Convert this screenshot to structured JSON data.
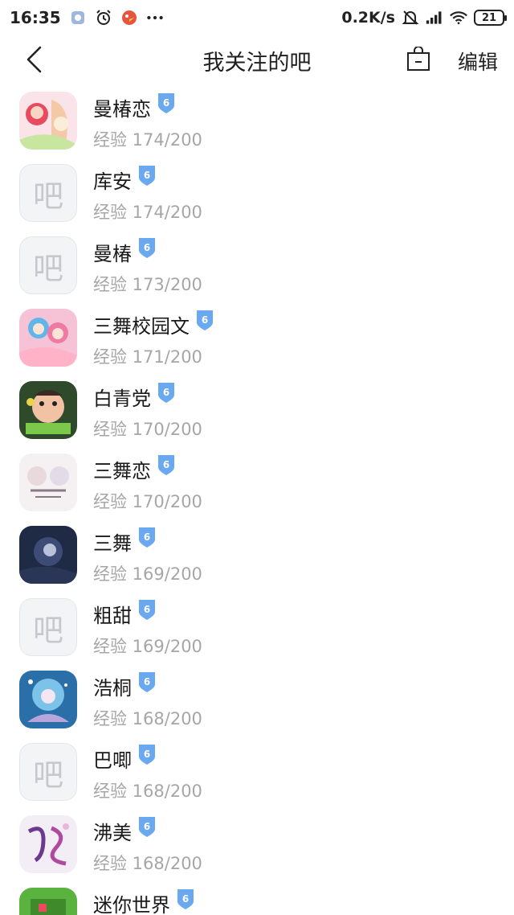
{
  "status_bar": {
    "time": "16:35",
    "net_speed": "0.2K/s",
    "battery": "21"
  },
  "nav": {
    "title": "我关注的吧",
    "edit_label": "编辑"
  },
  "placeholder_glyph": "吧",
  "badge_color": "#6aa8f0",
  "forums": [
    {
      "name": "曼椿恋",
      "level": "6",
      "exp": "经验 174/200",
      "avatar": "art-pink"
    },
    {
      "name": "库安",
      "level": "6",
      "exp": "经验 174/200",
      "avatar": "placeholder"
    },
    {
      "name": "曼椿",
      "level": "6",
      "exp": "经验 173/200",
      "avatar": "placeholder"
    },
    {
      "name": "三舞校园文",
      "level": "6",
      "exp": "经验 171/200",
      "avatar": "art-colorful"
    },
    {
      "name": "白青党",
      "level": "6",
      "exp": "经验 170/200",
      "avatar": "art-green"
    },
    {
      "name": "三舞恋",
      "level": "6",
      "exp": "经验 170/200",
      "avatar": "art-pale"
    },
    {
      "name": "三舞",
      "level": "6",
      "exp": "经验 169/200",
      "avatar": "art-dark"
    },
    {
      "name": "粗甜",
      "level": "6",
      "exp": "经验 169/200",
      "avatar": "placeholder"
    },
    {
      "name": "浩桐",
      "level": "6",
      "exp": "经验 168/200",
      "avatar": "art-blue"
    },
    {
      "name": "巴唧",
      "level": "6",
      "exp": "经验 168/200",
      "avatar": "placeholder"
    },
    {
      "name": "沸美",
      "level": "6",
      "exp": "经验 168/200",
      "avatar": "art-calligraphy"
    },
    {
      "name": "迷你世界",
      "level": "6",
      "exp": "",
      "avatar": "art-game"
    }
  ]
}
